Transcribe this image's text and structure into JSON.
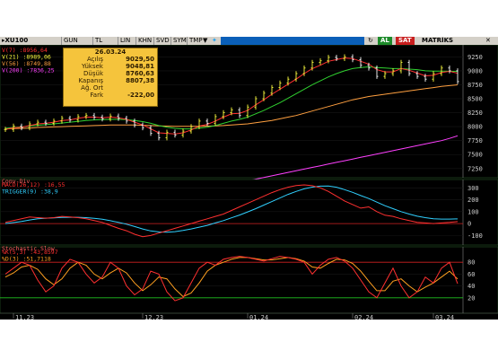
{
  "toolbar": {
    "symbol": "XU100",
    "buttons": [
      "GUN",
      "TL",
      "LIN",
      "KHN",
      "SVD",
      "SYM",
      "TMP"
    ],
    "dropdown_icon": "chevron-down-icon",
    "share_icon": "twitter-icon",
    "buy_label": "AL",
    "sell_label": "SAT",
    "brand": "MATRİKS",
    "colors": {
      "buy": "#1d8b2a",
      "sell": "#c81e1e",
      "strip": "#0a5fb8"
    }
  },
  "info": {
    "date": "26.03.24",
    "rows": [
      {
        "label": "Açılış",
        "value": "9029,50"
      },
      {
        "label": "Yüksek",
        "value": "9048,81"
      },
      {
        "label": "Düşük",
        "value": "8760,63"
      },
      {
        "label": "Kapanış",
        "value": "8807,38"
      },
      {
        "label": "Ağ. Ort",
        "value": ""
      },
      {
        "label": "Fark",
        "value": "-222,00"
      }
    ]
  },
  "chart_data": [
    {
      "type": "line",
      "title": "",
      "series_labels": [
        {
          "name": "V(7)",
          "value": "8956,64",
          "color": "#ff3030"
        },
        {
          "name": "V(21)",
          "value": "8989,06",
          "color": "#ffff40"
        },
        {
          "name": "V(56)",
          "value": "8749,88",
          "color": "#ffa040"
        },
        {
          "name": "V(200)",
          "value": "7836,25",
          "color": "#ff40ff"
        }
      ],
      "y_ticks": [
        "9250",
        "9000",
        "8750",
        "8500",
        "8250",
        "8000",
        "7750",
        "7500",
        "7250"
      ],
      "ylim": [
        7150,
        9400
      ],
      "price": [
        7950,
        8010,
        7980,
        8050,
        8080,
        8060,
        8100,
        8150,
        8120,
        8180,
        8200,
        8170,
        8140,
        8190,
        8150,
        8100,
        8030,
        7980,
        7880,
        7800,
        7900,
        7850,
        7920,
        8000,
        8100,
        8060,
        8180,
        8250,
        8300,
        8200,
        8350,
        8500,
        8600,
        8700,
        8780,
        8850,
        8950,
        9050,
        9150,
        9180,
        9240,
        9220,
        9250,
        9200,
        9100,
        9050,
        8900,
        8950,
        9000,
        9150,
        8950,
        8900,
        8850,
        8950,
        9050,
        9000,
        8807
      ],
      "ma_fast": [
        7950,
        7980,
        7990,
        8020,
        8050,
        8060,
        8080,
        8110,
        8120,
        8150,
        8170,
        8170,
        8160,
        8170,
        8160,
        8130,
        8080,
        8030,
        7960,
        7890,
        7880,
        7870,
        7890,
        7940,
        8010,
        8040,
        8100,
        8170,
        8230,
        8240,
        8290,
        8390,
        8480,
        8580,
        8670,
        8760,
        8850,
        8950,
        9040,
        9100,
        9170,
        9200,
        9230,
        9220,
        9170,
        9120,
        9020,
        8980,
        8980,
        9040,
        9010,
        8960,
        8910,
        8920,
        8970,
        8990,
        8956
      ],
      "ma_mid": [
        7970,
        7985,
        7995,
        8010,
        8025,
        8035,
        8050,
        8065,
        8080,
        8095,
        8110,
        8120,
        8125,
        8130,
        8130,
        8125,
        8110,
        8090,
        8060,
        8020,
        7990,
        7970,
        7960,
        7960,
        7975,
        7990,
        8020,
        8060,
        8100,
        8130,
        8170,
        8230,
        8290,
        8360,
        8430,
        8510,
        8590,
        8670,
        8750,
        8820,
        8890,
        8950,
        9000,
        9040,
        9060,
        9070,
        9060,
        9050,
        9040,
        9040,
        9030,
        9020,
        9000,
        8995,
        8995,
        8992,
        8989
      ],
      "ma_slow": [
        7960,
        7965,
        7970,
        7975,
        7985,
        7990,
        7995,
        8000,
        8005,
        8010,
        8015,
        8020,
        8025,
        8030,
        8030,
        8030,
        8030,
        8025,
        8020,
        8015,
        8010,
        8005,
        8005,
        8005,
        8005,
        8010,
        8015,
        8020,
        8030,
        8040,
        8050,
        8070,
        8090,
        8110,
        8140,
        8170,
        8200,
        8240,
        8280,
        8320,
        8360,
        8400,
        8440,
        8480,
        8510,
        8540,
        8560,
        8580,
        8600,
        8620,
        8640,
        8660,
        8680,
        8700,
        8720,
        8735,
        8749
      ],
      "ma_long": [
        null,
        null,
        null,
        null,
        null,
        null,
        null,
        null,
        null,
        null,
        null,
        null,
        null,
        null,
        null,
        null,
        null,
        null,
        null,
        null,
        null,
        null,
        null,
        null,
        null,
        null,
        null,
        null,
        null,
        null,
        7030,
        7060,
        7090,
        7120,
        7150,
        7180,
        7210,
        7240,
        7270,
        7300,
        7330,
        7360,
        7390,
        7420,
        7450,
        7480,
        7510,
        7540,
        7570,
        7600,
        7630,
        7660,
        7690,
        7720,
        7750,
        7790,
        7836
      ]
    },
    {
      "type": "line",
      "title": "Conv-Div",
      "series_labels": [
        {
          "name": "MACD(26,12)",
          "value": "16,55",
          "color": "#ff3030"
        },
        {
          "name": "TRIGGER(9)",
          "value": "38,9",
          "color": "#30d0ff"
        }
      ],
      "y_ticks": [
        "300",
        "200",
        "100",
        "0",
        "-100"
      ],
      "ylim": [
        -150,
        340
      ],
      "macd": [
        10,
        25,
        40,
        55,
        50,
        45,
        50,
        60,
        55,
        50,
        40,
        25,
        10,
        -15,
        -40,
        -60,
        -90,
        -110,
        -100,
        -80,
        -60,
        -40,
        -20,
        0,
        20,
        40,
        60,
        80,
        110,
        140,
        170,
        200,
        230,
        260,
        285,
        305,
        320,
        325,
        318,
        300,
        270,
        230,
        190,
        160,
        130,
        140,
        100,
        70,
        60,
        40,
        25,
        10,
        5,
        0,
        5,
        10,
        16.55
      ],
      "trigger": [
        0,
        8,
        18,
        30,
        40,
        45,
        48,
        52,
        53,
        53,
        50,
        44,
        36,
        24,
        10,
        -5,
        -25,
        -45,
        -62,
        -70,
        -72,
        -68,
        -58,
        -45,
        -30,
        -15,
        5,
        25,
        48,
        72,
        98,
        125,
        155,
        185,
        215,
        245,
        270,
        292,
        306,
        314,
        315,
        305,
        285,
        262,
        235,
        210,
        180,
        150,
        125,
        100,
        80,
        62,
        50,
        40,
        38,
        38,
        38.9
      ]
    },
    {
      "type": "line",
      "title": "Stochastic Slow",
      "series_labels": [
        {
          "name": "%K(5,3)",
          "value": "43,8597",
          "color": "#ff3030"
        },
        {
          "name": "%D(3)",
          "value": "51,7118",
          "color": "#ffa020"
        }
      ],
      "y_ticks": [
        "80",
        "60",
        "40",
        "20"
      ],
      "ylim": [
        0,
        100
      ],
      "k": [
        60,
        70,
        80,
        75,
        50,
        30,
        40,
        70,
        85,
        80,
        60,
        45,
        55,
        80,
        70,
        40,
        25,
        35,
        65,
        60,
        30,
        15,
        20,
        45,
        70,
        80,
        75,
        85,
        88,
        90,
        88,
        85,
        82,
        86,
        90,
        88,
        85,
        80,
        60,
        75,
        85,
        88,
        82,
        70,
        50,
        30,
        20,
        45,
        70,
        40,
        20,
        30,
        55,
        45,
        70,
        80,
        43.86
      ],
      "d": [
        55,
        62,
        72,
        75,
        68,
        52,
        42,
        52,
        70,
        80,
        75,
        60,
        52,
        62,
        70,
        62,
        45,
        32,
        42,
        55,
        52,
        35,
        22,
        28,
        45,
        65,
        75,
        80,
        85,
        88,
        88,
        86,
        84,
        84,
        86,
        88,
        86,
        82,
        72,
        70,
        78,
        85,
        84,
        78,
        65,
        48,
        32,
        32,
        48,
        52,
        40,
        30,
        38,
        45,
        55,
        65,
        51.71
      ]
    }
  ],
  "x_axis": {
    "labels": [
      "11.23",
      "12.23",
      "01.24",
      "02.24",
      "03.24"
    ]
  },
  "colors": {
    "up": "#ffff40",
    "down": "#ffffff",
    "grid": "#1a1a1a"
  }
}
